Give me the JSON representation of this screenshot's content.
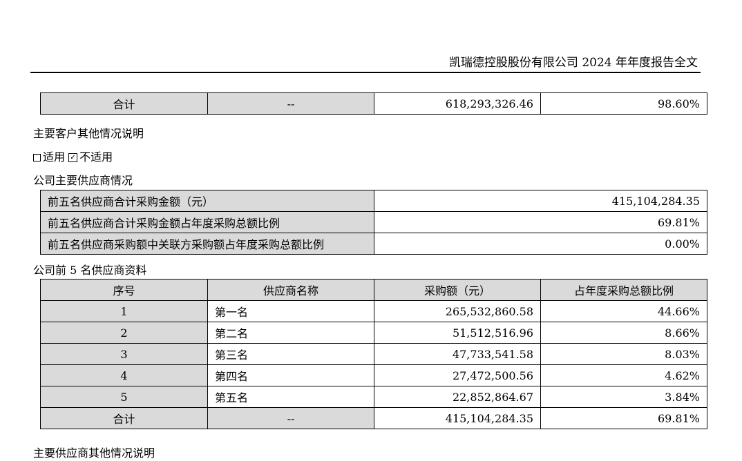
{
  "header": {
    "title": "凯瑞德控股股份有限公司 2024 年年度报告全文"
  },
  "top_total": {
    "label": "合计",
    "name": "--",
    "amount": "618,293,326.46",
    "ratio": "98.60%"
  },
  "customer_note": {
    "title": "主要客户其他情况说明",
    "option_na1": "适用",
    "option_na2": "不适用"
  },
  "supplier_summary": {
    "title": "公司主要供应商情况",
    "rows": [
      {
        "label": "前五名供应商合计采购金额（元）",
        "value": "415,104,284.35"
      },
      {
        "label": "前五名供应商合计采购金额占年度采购总额比例",
        "value": "69.81%"
      },
      {
        "label": "前五名供应商采购额中关联方采购额占年度采购总额比例",
        "value": "0.00%"
      }
    ]
  },
  "top5": {
    "title": "公司前 5 名供应商资料",
    "headers": [
      "序号",
      "供应商名称",
      "采购额（元）",
      "占年度采购总额比例"
    ],
    "rows": [
      {
        "no": "1",
        "name": "第一名",
        "amount": "265,532,860.58",
        "ratio": "44.66%"
      },
      {
        "no": "2",
        "name": "第二名",
        "amount": "51,512,516.96",
        "ratio": "8.66%"
      },
      {
        "no": "3",
        "name": "第三名",
        "amount": "47,733,541.58",
        "ratio": "8.03%"
      },
      {
        "no": "4",
        "name": "第四名",
        "amount": "27,472,500.56",
        "ratio": "4.62%"
      },
      {
        "no": "5",
        "name": "第五名",
        "amount": "22,852,864.67",
        "ratio": "3.84%"
      }
    ],
    "total": {
      "label": "合计",
      "name": "--",
      "amount": "415,104,284.35",
      "ratio": "69.81%"
    }
  },
  "supplier_note": {
    "title": "主要供应商其他情况说明"
  }
}
